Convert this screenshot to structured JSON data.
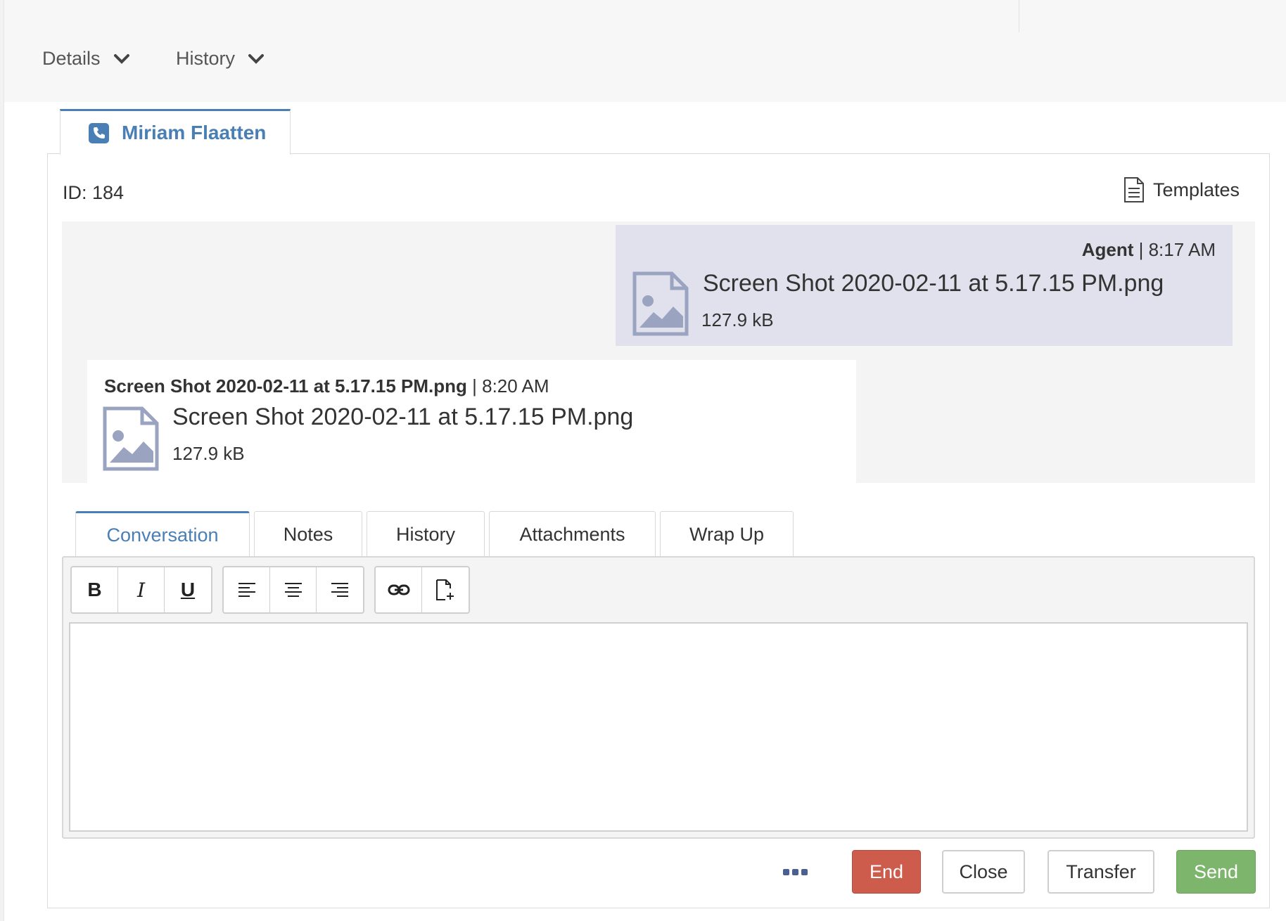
{
  "header": {
    "details_label": "Details",
    "history_label": "History"
  },
  "contact_tab": {
    "name": "Miriam Flaatten",
    "icon": "phone-icon"
  },
  "panel": {
    "id_label": "ID: 184",
    "templates_label": "Templates"
  },
  "messages": [
    {
      "sender": "Agent",
      "separator": " | ",
      "time": "8:17 AM",
      "file_name": "Screen Shot 2020-02-11 at 5.17.15 PM.png",
      "file_size": "127.9 kB",
      "icon": "image-file-icon"
    },
    {
      "sender": "Screen Shot 2020-02-11 at 5.17.15 PM.png",
      "separator": " | ",
      "time": "8:20 AM",
      "file_name": "Screen Shot 2020-02-11 at 5.17.15 PM.png",
      "file_size": "127.9 kB",
      "icon": "image-file-icon"
    }
  ],
  "tabs": [
    {
      "label": "Conversation",
      "active": true
    },
    {
      "label": "Notes",
      "active": false
    },
    {
      "label": "History",
      "active": false
    },
    {
      "label": "Attachments",
      "active": false
    },
    {
      "label": "Wrap Up",
      "active": false
    }
  ],
  "toolbar": {
    "bold": "B",
    "italic": "I",
    "underline": "U"
  },
  "editor": {
    "value": ""
  },
  "actions": {
    "end": "End",
    "close": "Close",
    "transfer": "Transfer",
    "send": "Send"
  },
  "colors": {
    "accent": "#4a7fb5",
    "end": "#cd5c4d",
    "send": "#7cb56b",
    "agent_bubble": "#e0e1ec"
  }
}
